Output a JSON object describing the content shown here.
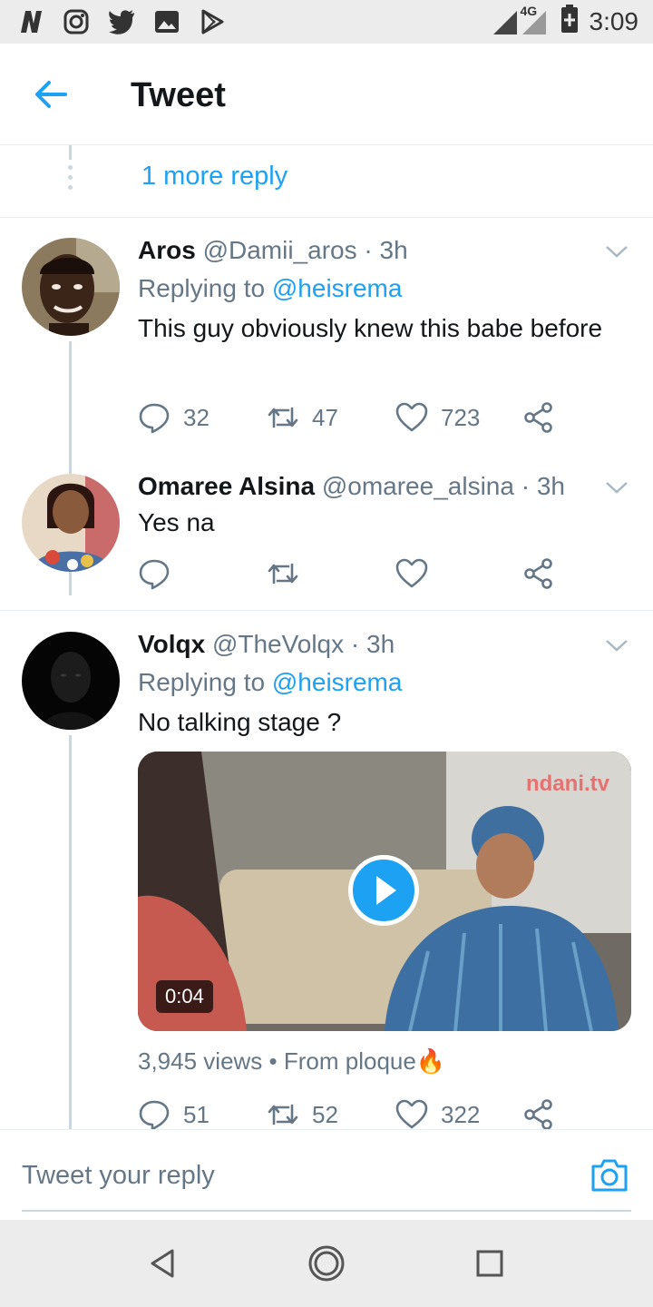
{
  "status_bar": {
    "time": "3:09",
    "network": "4G",
    "left_icons": [
      "n-icon",
      "instagram-icon",
      "twitter-icon",
      "gallery-icon",
      "play-store-icon"
    ],
    "right_icons": [
      "signal-icon",
      "battery-icon"
    ]
  },
  "header": {
    "title": "Tweet"
  },
  "thread": {
    "more_replies_label": "1 more reply"
  },
  "tweets": [
    {
      "name": "Aros",
      "handle": "@Damii_aros",
      "time": "· 3h",
      "replying_prefix": "Replying to",
      "replying_to": "@heisrema",
      "text": "This guy obviously knew this babe before",
      "replies": "32",
      "retweets": "47",
      "likes": "723"
    },
    {
      "name": "Omaree Alsina",
      "handle": "@omaree_alsina",
      "time": "· 3h",
      "text": "Yes na",
      "replies": "",
      "retweets": "",
      "likes": ""
    },
    {
      "name": "Volqx",
      "handle": "@TheVolqx",
      "time": "· 3h",
      "replying_prefix": "Replying to",
      "replying_to": "@heisrema",
      "text": "No talking stage ?",
      "video": {
        "duration": "0:04",
        "watermark": "ndani.tv"
      },
      "views": "3,945 views",
      "source": "• From ploque🔥",
      "replies": "51",
      "retweets": "52",
      "likes": "322"
    }
  ],
  "reply_bar": {
    "placeholder": "Tweet your reply"
  },
  "colors": {
    "accent": "#1da1f2",
    "secondary_text": "#657786",
    "divider": "#e6ecf0"
  }
}
